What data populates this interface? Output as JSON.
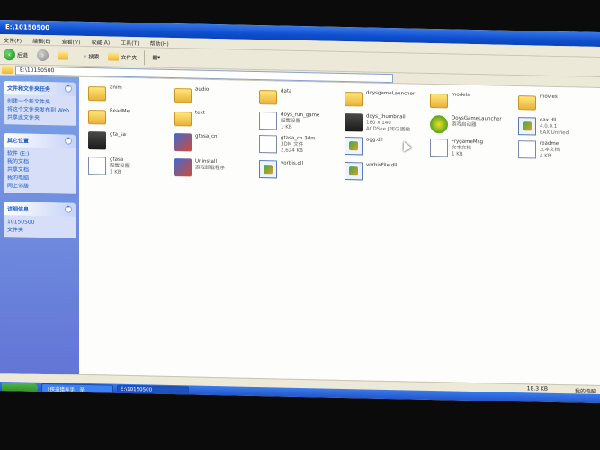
{
  "window": {
    "title": "E:\\10150500"
  },
  "menu": [
    "文件(F)",
    "编辑(E)",
    "查看(V)",
    "收藏(A)",
    "工具(T)",
    "帮助(H)"
  ],
  "toolbar": {
    "back": "后退",
    "search": "搜索",
    "folders": "文件夹"
  },
  "address": {
    "value": "E:\\10150500"
  },
  "sidebar": {
    "tasks": {
      "title": "文件和文件夹任务",
      "items": [
        "创建一个新文件夹",
        "将这个文件夹发布到 Web",
        "共享此文件夹"
      ]
    },
    "places": {
      "title": "其它位置",
      "items": [
        "软件 (E:)",
        "我的文档",
        "共享文档",
        "我的电脑",
        "网上邻居"
      ]
    },
    "details": {
      "title": "详细信息",
      "items": [
        "10150500",
        "文件夹"
      ]
    }
  },
  "files": [
    {
      "name": "anim",
      "kind": "folder"
    },
    {
      "name": "audio",
      "kind": "folder"
    },
    {
      "name": "data",
      "kind": "folder"
    },
    {
      "name": "doysgameLauncher",
      "kind": "folder"
    },
    {
      "name": "models",
      "kind": "folder"
    },
    {
      "name": "movies",
      "kind": "folder"
    },
    {
      "name": "ReadMe",
      "kind": "folder"
    },
    {
      "name": "text",
      "kind": "folder"
    },
    {
      "name": "doys_run_game",
      "sub1": "配置设置",
      "sub2": "1 KB",
      "kind": "doc"
    },
    {
      "name": "doys_thumbnail",
      "sub1": "180 x 140",
      "sub2": "ACDSee JPEG 图像",
      "kind": "img"
    },
    {
      "name": "DoysGameLauncher",
      "sub1": "游戏启动器",
      "kind": "pac"
    },
    {
      "name": "eax.dll",
      "sub1": "4.0.0.1",
      "sub2": "EAX Unified",
      "kind": "dll"
    },
    {
      "name": "gta_sa",
      "kind": "img"
    },
    {
      "name": "gtasa_cn",
      "kind": "exe"
    },
    {
      "name": "gtasa_cn.3dm",
      "sub1": "3DM 文件",
      "sub2": "2,624 KB",
      "kind": "doc"
    },
    {
      "name": "ogg.dll",
      "kind": "dll"
    },
    {
      "name": "FrygameMsg",
      "sub1": "文本文档",
      "sub2": "1 KB",
      "kind": "doc"
    },
    {
      "name": "readme",
      "sub1": "文本文档",
      "sub2": "4 KB",
      "kind": "doc"
    },
    {
      "name": "gtasa",
      "sub1": "配置设置",
      "sub2": "1 KB",
      "kind": "doc"
    },
    {
      "name": "Uninstall",
      "sub1": "游戏卸载程序",
      "kind": "exe"
    },
    {
      "name": "vorbis.dll",
      "kind": "dll"
    },
    {
      "name": "vorbisFile.dll",
      "kind": "dll"
    }
  ],
  "status": {
    "size": "18.3 KB",
    "zone": "我的电脑"
  },
  "taskbar": {
    "items": [
      "《侠盗猎车手：圣",
      "E:\\10150500"
    ]
  }
}
